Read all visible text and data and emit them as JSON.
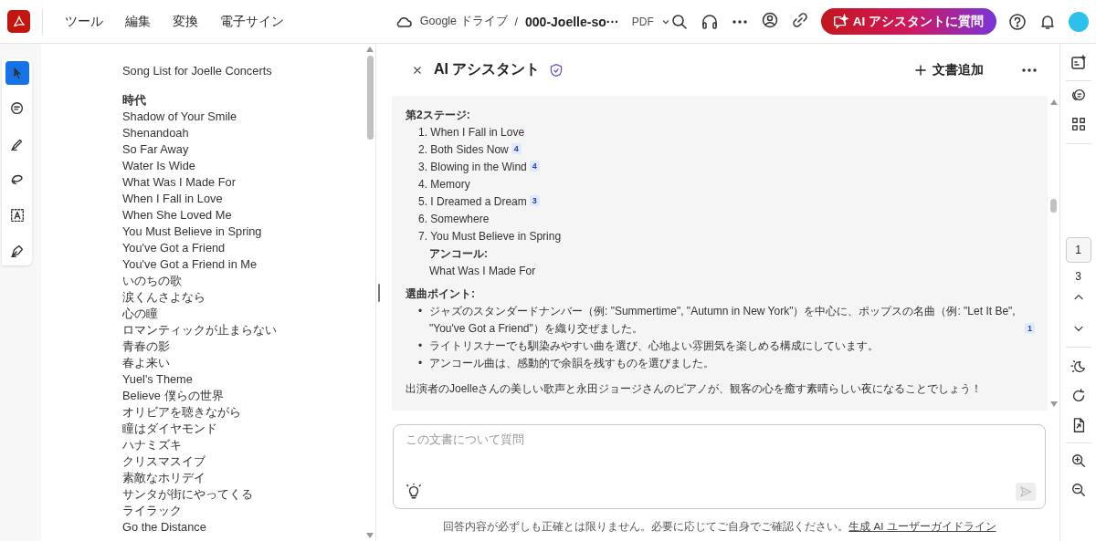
{
  "toolbar": {
    "menu": [
      "ツール",
      "編集",
      "変換",
      "電子サイン"
    ],
    "location": "Google ドライブ",
    "separator": "/",
    "filename": "000-Joelle-so···",
    "file_type": "PDF",
    "ai_button": "AI アシスタントに質問"
  },
  "tools": [
    {
      "kind": "select",
      "selected": true
    },
    {
      "kind": "comment",
      "selected": false
    },
    {
      "kind": "highlight",
      "selected": false
    },
    {
      "kind": "lasso",
      "selected": false
    },
    {
      "kind": "textbox",
      "selected": false
    },
    {
      "kind": "sign",
      "selected": false
    }
  ],
  "document": {
    "title": "Song List for Joelle Concerts",
    "heading": "時代",
    "songs": [
      "Shadow of Your Smile",
      "Shenandoah",
      "So Far Away",
      "Water Is Wide",
      "What Was I Made For",
      "When I Fall in Love",
      "When She Loved Me",
      "You Must Believe in Spring",
      "You've Got a Friend",
      "You've Got a Friend in Me",
      "いのちの歌",
      "涙くんさよなら",
      "心の瞳",
      "ロマンティックが止まらない",
      "青春の影",
      "春よ来い",
      "Yuel's Theme",
      "Believe 僕らの世界",
      "オリビアを聴きながら",
      "瞳はダイヤモンド",
      "ハナミズキ",
      "クリスマスイブ",
      "素敵なホリデイ",
      "サンタが街にやってくる",
      "ライラック",
      "Go the Distance"
    ]
  },
  "assistant": {
    "title": "AI アシスタント",
    "add_document": "文書追加",
    "response": {
      "stage_title": "第2ステージ:",
      "stage_songs": [
        {
          "number": "1.",
          "title": "When I Fall in Love"
        },
        {
          "number": "2.",
          "title": "Both Sides Now",
          "cite": "4"
        },
        {
          "number": "3.",
          "title": "Blowing in the Wind",
          "cite": "4"
        },
        {
          "number": "4.",
          "title": "Memory"
        },
        {
          "number": "5.",
          "title": "I Dreamed a Dream",
          "cite": "3"
        },
        {
          "number": "6.",
          "title": "Somewhere"
        },
        {
          "number": "7.",
          "title": "You Must Believe in Spring"
        }
      ],
      "encore_label": "アンコール:",
      "encore_song": "What Was I Made For",
      "points_title": "選曲ポイント:",
      "points": [
        {
          "marker": "•",
          "text": "ジャズのスタンダードナンバー（例: \"Summertime\", \"Autumn in New York\"）を中心に、ポップスの名曲（例: \"Let It Be\", \"You've Got a Friend\"）を織り交ぜました。",
          "cite": "1"
        },
        {
          "marker": "•",
          "text": "ライトリスナーでも馴染みやすい曲を選び、心地よい雰囲気を楽しめる構成にしています。"
        },
        {
          "marker": "•",
          "text": "アンコール曲は、感動的で余韻を残すものを選びました。"
        }
      ],
      "closing": "出演者のJoelleさんの美しい歌声と永田ジョージさんのピアノが、観客の心を癒す素晴らしい夜になることでしょう！"
    },
    "input": {
      "placeholder": "この文書について質問"
    },
    "disclaimer": "回答内容が必ずしも正確とは限りません。必要に応じてご自身でご確認ください。",
    "guideline_link": "生成 AI ユーザーガイドライン"
  },
  "page_nav": {
    "current": "1",
    "total": "3"
  }
}
